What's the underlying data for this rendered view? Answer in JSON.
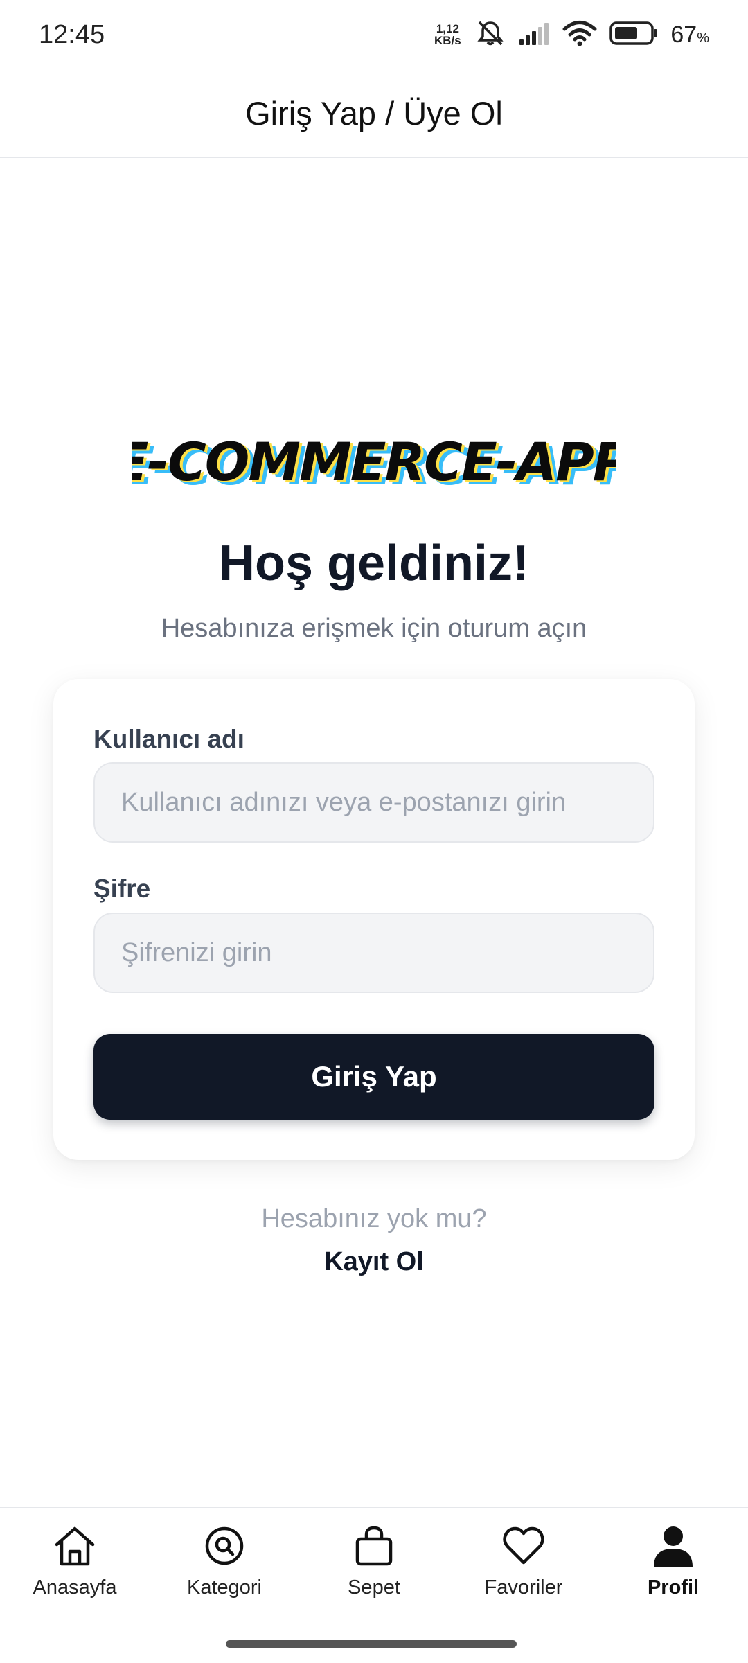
{
  "status_bar": {
    "time": "12:45",
    "net_speed_value": "1,12",
    "net_speed_unit": "KB/s",
    "battery_percent": "67",
    "battery_symbol": "%",
    "battery_level": 0.67,
    "icons": [
      "bell-muted-icon",
      "signal-icon",
      "wifi-icon",
      "battery-icon"
    ]
  },
  "header": {
    "title": "Giriş Yap / Üye Ol"
  },
  "logo": {
    "text": "E-COMMERCE-APP"
  },
  "welcome": {
    "title": "Hoş geldiniz!",
    "subtitle": "Hesabınıza erişmek için oturum açın"
  },
  "form": {
    "username_label": "Kullanıcı adı",
    "username_placeholder": "Kullanıcı adınızı veya e-postanızı girin",
    "username_value": "",
    "password_label": "Şifre",
    "password_placeholder": "Şifrenizi girin",
    "password_value": "",
    "submit_label": "Giriş Yap"
  },
  "footer": {
    "no_account": "Hesabınız yok mu?",
    "register_label": "Kayıt Ol"
  },
  "nav": {
    "items": [
      {
        "label": "Anasayfa",
        "icon": "home-icon"
      },
      {
        "label": "Kategori",
        "icon": "search-icon"
      },
      {
        "label": "Sepet",
        "icon": "bag-icon"
      },
      {
        "label": "Favoriler",
        "icon": "heart-icon"
      },
      {
        "label": "Profil",
        "icon": "person-icon",
        "active": true
      }
    ]
  },
  "colors": {
    "primary": "#111827",
    "muted_text": "#6b7280",
    "placeholder": "#9ca3af",
    "input_bg": "#f3f4f6",
    "logo_shadow_cyan": "#38bdf8",
    "logo_shadow_yellow": "#fde047"
  }
}
